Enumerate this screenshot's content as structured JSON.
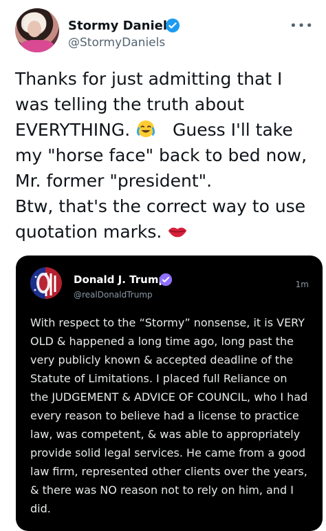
{
  "tweet": {
    "author_name": "Stormy Daniels",
    "author_handle": "@StormyDaniels",
    "more_label": "•••",
    "text_part1": "Thanks for just admitting that I was telling the truth about EVERYTHING.",
    "text_part2": "Guess I'll take my \"horse face\" back to bed now, Mr. former \"president\".\nBtw, that's the correct way to use quotation marks.",
    "emoji_1": "face-with-tears-of-joy-icon",
    "emoji_2": "kiss-mark-icon"
  },
  "quoted_post": {
    "author_name": "Donald J. Trump",
    "author_handle": "@realDonaldTrump",
    "timestamp": "1m",
    "text": "With respect to the “Stormy” nonsense, it is VERY OLD & happened a long time ago, long past the very publicly known & accepted deadline of the Statute of Limitations. I placed full Reliance on the JUDGEMENT & ADVICE OF COUNCIL, who I had every reason to believe had a license to practice law, was competent, & was able to appropriately provide solid legal services. He came from a good law firm, represented other clients over the years, & there was NO reason not to rely on him, and I did."
  },
  "colors": {
    "twitter_blue": "#1d9bf0",
    "truth_social_purple": "#8f6fff",
    "text_primary": "#0f1419",
    "text_secondary": "#536471"
  }
}
